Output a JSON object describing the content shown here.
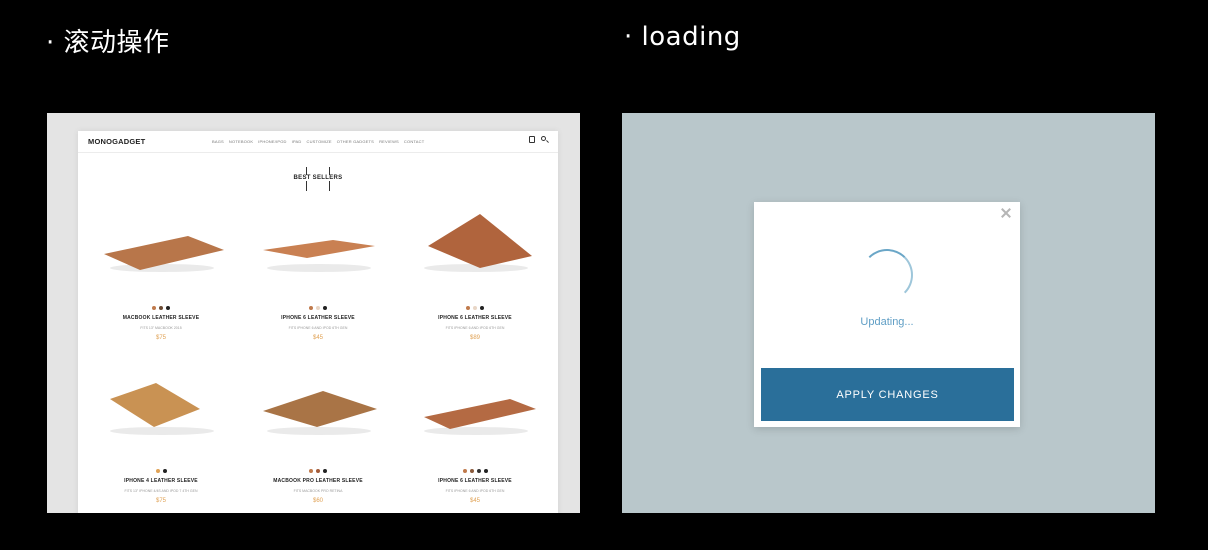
{
  "captions": {
    "left": "· 滚动操作",
    "right": "· loading"
  },
  "site": {
    "logo": "MONOGADGET",
    "nav": [
      "BAGS",
      "NOTEBOOK",
      "IPHONE/IPOD",
      "IPAD",
      "CUSTOMIZE",
      "OTHER GADGETS",
      "REVIEWS",
      "CONTACT"
    ],
    "section_title": "BEST SELLERS",
    "products": [
      {
        "name": "MACBOOK LEATHER SLEEVE",
        "sub": "FITS 13\" MACBOOK 2015",
        "price": "$75",
        "swatches": [
          "#c07a4c",
          "#6b4a33",
          "#222222"
        ],
        "leather": "#b8764a"
      },
      {
        "name": "IPHONE 6 LEATHER SLEEVE",
        "sub": "FITS IPHONE 6 AND IPOD 6TH GEN",
        "price": "$45",
        "swatches": [
          "#c07a4c",
          "#e8d6c6",
          "#222222"
        ],
        "leather": "#c98052"
      },
      {
        "name": "IPHONE 6 LEATHER SLEEVE",
        "sub": "FITS IPHONE 6 AND IPOD 6TH GEN",
        "price": "$89",
        "swatches": [
          "#c07a4c",
          "#e8d6c6",
          "#222222"
        ],
        "leather": "#b0643d"
      },
      {
        "name": "IPHONE 4 LEATHER SLEEVE",
        "sub": "FITS 13\" IPHONE 4/4S AND IPOD 7 4TH GEN",
        "price": "$75",
        "swatches": [
          "#e0a255",
          "#222222"
        ],
        "leather": "#c99253"
      },
      {
        "name": "MACBOOK PRO LEATHER SLEEVE",
        "sub": "FITS MACBOOK PRO RETINA",
        "price": "$60",
        "swatches": [
          "#c07a4c",
          "#a35b39",
          "#222222"
        ],
        "leather": "#a97446"
      },
      {
        "name": "IPHONE 6 LEATHER SLEEVE",
        "sub": "FITS IPHONE 6 AND IPOD 6TH GEN",
        "price": "$45",
        "swatches": [
          "#c07a4c",
          "#8a5a3c",
          "#333333",
          "#222222"
        ],
        "leather": "#b46a43"
      }
    ]
  },
  "modal": {
    "status": "Updating...",
    "button": "APPLY CHANGES",
    "accent": "#2a6f9a",
    "spinner_color": "#6aa6c7",
    "close_icon": "close-icon"
  },
  "colors": {
    "background": "#000000",
    "right_panel": "#b9c7cb",
    "price": "#e0a255"
  }
}
